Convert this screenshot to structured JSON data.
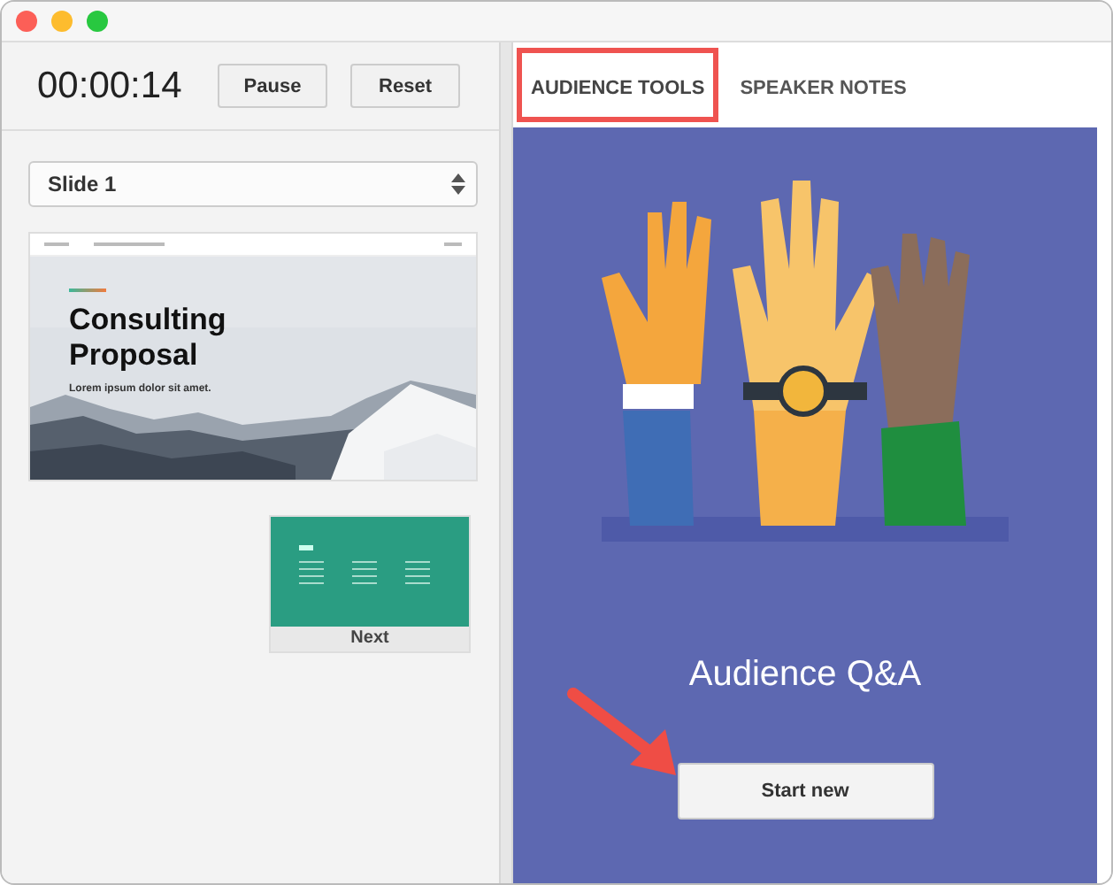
{
  "timer": {
    "time": "00:00:14",
    "buttons": [
      "Pause",
      "Reset"
    ]
  },
  "slide_select": {
    "value": "Slide 1"
  },
  "current_slide": {
    "title": "Consulting Proposal",
    "subtitle": "Lorem ipsum dolor sit amet."
  },
  "next_slide": {
    "label": "Next"
  },
  "tabs": [
    {
      "label": "AUDIENCE TOOLS",
      "selected": true
    },
    {
      "label": "SPEAKER NOTES",
      "selected": false
    }
  ],
  "audience_qa": {
    "title": "Audience Q&A",
    "button": "Start new"
  }
}
